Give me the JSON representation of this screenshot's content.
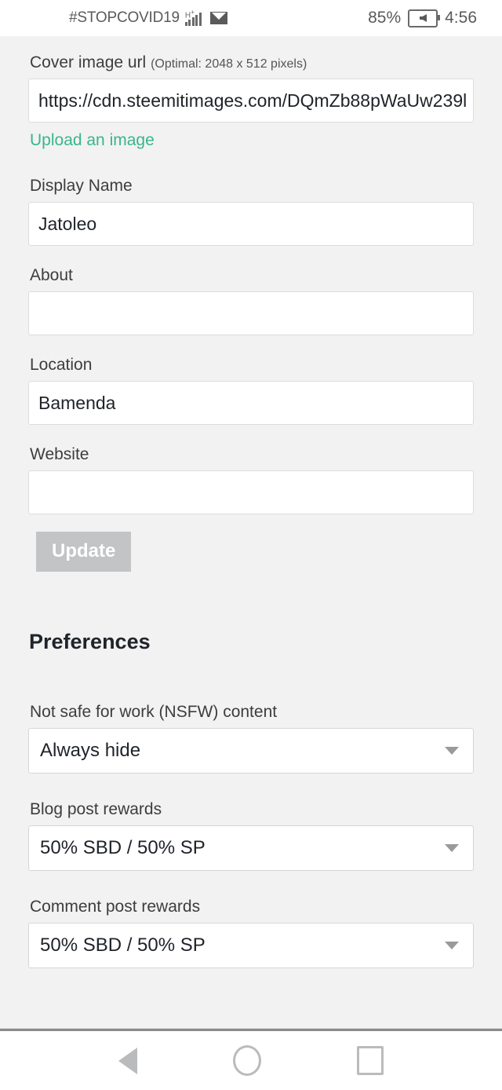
{
  "status_bar": {
    "carrier": "#STOPCOVID19",
    "signal_icon": "signal-bars-h-plus-icon",
    "mail_icon": "envelope-icon",
    "battery_percent": "85%",
    "battery_icon": "battery-charging-icon",
    "time": "4:56"
  },
  "form": {
    "cover_image": {
      "label": "Cover image url",
      "hint": "(Optimal: 2048 x 512 pixels)",
      "value": "https://cdn.steemitimages.com/DQmZb88pWaUw239l",
      "placeholder": "",
      "upload_link": "Upload an image"
    },
    "display_name": {
      "label": "Display Name",
      "value": "Jatoleo",
      "placeholder": ""
    },
    "about": {
      "label": "About",
      "value": "",
      "placeholder": ""
    },
    "location": {
      "label": "Location",
      "value": "Bamenda",
      "placeholder": ""
    },
    "website": {
      "label": "Website",
      "value": "",
      "placeholder": ""
    },
    "update_button": "Update"
  },
  "preferences": {
    "title": "Preferences",
    "nsfw": {
      "label": "Not safe for work (NSFW) content",
      "value": "Always hide"
    },
    "blog_rewards": {
      "label": "Blog post rewards",
      "value": "50% SBD / 50% SP"
    },
    "comment_rewards": {
      "label": "Comment post rewards",
      "value": "50% SBD / 50% SP"
    }
  },
  "nav_bar": {
    "back": "back-icon",
    "home": "home-icon",
    "recents": "recents-icon"
  },
  "colors": {
    "page_background": "#f2f2f2",
    "accent_link": "#39b68a",
    "button_disabled": "#c2c4c6",
    "text_primary": "#20242a"
  }
}
